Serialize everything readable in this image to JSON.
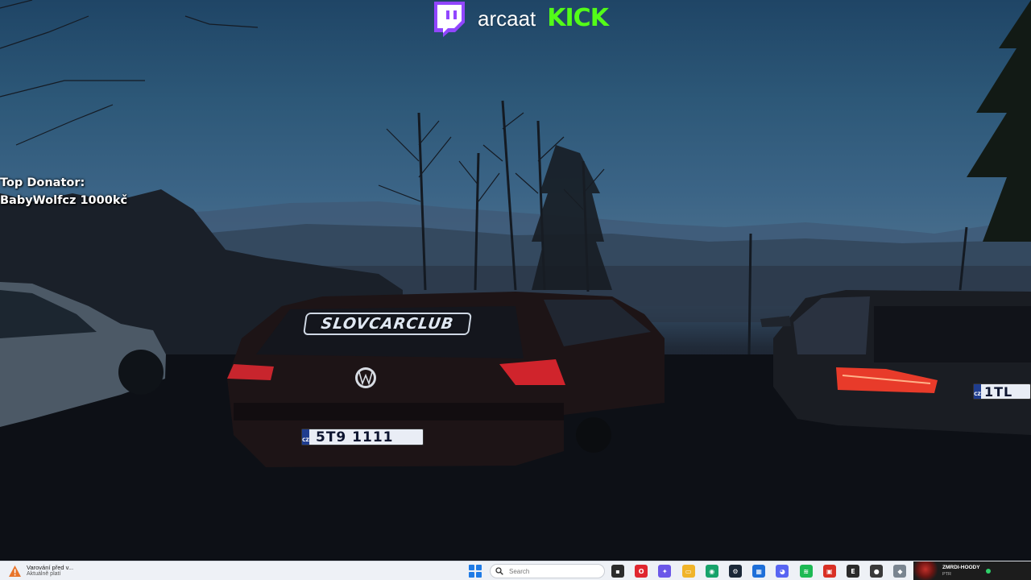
{
  "overlay": {
    "channel_name": "arcaat",
    "kick_logo_text": "KICK",
    "twitch_icon": "twitch-icon",
    "top_donator_label": "Top Donator:",
    "top_donator_value": "BabyWolfcz 1000kč"
  },
  "wallpaper": {
    "sticker_text": "SLOVCARCLUB",
    "plate_vw": "5T9 1111",
    "plate_bmw": "1TL",
    "plate_country": "CZ"
  },
  "taskbar": {
    "widget": {
      "icon": "warning-icon",
      "title": "Varování před v...",
      "subtitle": "Aktuálně platí"
    },
    "start_icon": "windows-start-icon",
    "search": {
      "placeholder": "Search",
      "icon": "search-icon"
    },
    "apps": [
      {
        "name": "task-view-icon",
        "color": "#2c2c2c",
        "glyph": "▪"
      },
      {
        "name": "opera-icon",
        "color": "#e0262f",
        "glyph": "O"
      },
      {
        "name": "copilot-icon",
        "color": "#6b57e8",
        "glyph": "✦"
      },
      {
        "name": "file-explorer-icon",
        "color": "#f0b429",
        "glyph": "▭"
      },
      {
        "name": "app-green-icon",
        "color": "#17a36b",
        "glyph": "◉"
      },
      {
        "name": "steam-icon",
        "color": "#1b2838",
        "glyph": "⚙"
      },
      {
        "name": "app-blue-icon",
        "color": "#1e6fd9",
        "glyph": "▦"
      },
      {
        "name": "discord-icon",
        "color": "#5865f2",
        "glyph": "◕"
      },
      {
        "name": "spotify-icon",
        "color": "#1db954",
        "glyph": "≋"
      },
      {
        "name": "app-red-icon",
        "color": "#d93025",
        "glyph": "▣"
      },
      {
        "name": "epic-games-icon",
        "color": "#2a2a2a",
        "glyph": "E"
      },
      {
        "name": "app-dark-icon",
        "color": "#3a3a3a",
        "glyph": "●"
      },
      {
        "name": "app-gray-icon",
        "color": "#7a8590",
        "glyph": "◆"
      },
      {
        "name": "nvidia-icon",
        "color": "#1f1f1f",
        "glyph": "▲"
      }
    ],
    "now_playing": {
      "title": "ZMRDI-HOODY",
      "subtitle": "PTR"
    }
  }
}
